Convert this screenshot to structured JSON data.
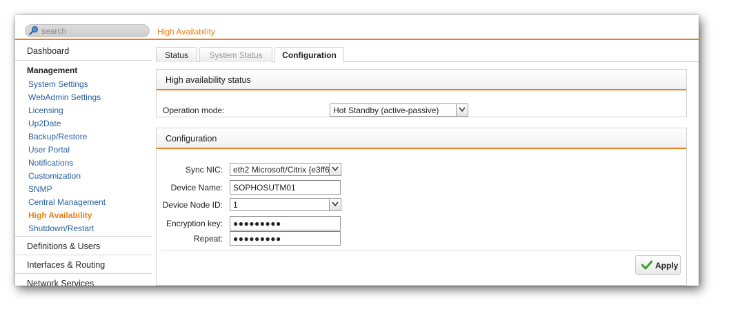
{
  "search": {
    "placeholder": "search"
  },
  "header": {
    "title": "High Availability"
  },
  "sidebar": {
    "dashboard": "Dashboard",
    "section_title": "Management",
    "items": [
      {
        "label": "System Settings",
        "active": false
      },
      {
        "label": "WebAdmin Settings",
        "active": false
      },
      {
        "label": "Licensing",
        "active": false
      },
      {
        "label": "Up2Date",
        "active": false
      },
      {
        "label": "Backup/Restore",
        "active": false
      },
      {
        "label": "User Portal",
        "active": false
      },
      {
        "label": "Notifications",
        "active": false
      },
      {
        "label": "Customization",
        "active": false
      },
      {
        "label": "SNMP",
        "active": false
      },
      {
        "label": "Central Management",
        "active": false
      },
      {
        "label": "High Availability",
        "active": true
      },
      {
        "label": "Shutdown/Restart",
        "active": false
      }
    ],
    "groups": [
      "Definitions & Users",
      "Interfaces & Routing",
      "Network Services"
    ]
  },
  "tabs": [
    {
      "label": "Status",
      "state": "normal"
    },
    {
      "label": "System Status",
      "state": "disabled"
    },
    {
      "label": "Configuration",
      "state": "active"
    }
  ],
  "ha_status": {
    "title": "High availability status",
    "operation_mode_label": "Operation mode:",
    "operation_mode_value": "Hot Standby (active-passive)"
  },
  "config": {
    "title": "Configuration",
    "sync_nic_label": "Sync NIC:",
    "sync_nic_value": "eth2 Microsoft/Citrix {e3ff6",
    "device_name_label": "Device Name:",
    "device_name_value": "SOPHOSUTM01",
    "device_node_id_label": "Device Node ID:",
    "device_node_id_value": "1",
    "encryption_key_label": "Encryption key:",
    "encryption_key_value": "●●●●●●●●●",
    "repeat_label": "Repeat:",
    "repeat_value": "●●●●●●●●●",
    "apply_label": "Apply"
  },
  "colors": {
    "accent": "#e8801a",
    "link": "#2a5fa0",
    "apply_check": "#3a9a2a"
  }
}
